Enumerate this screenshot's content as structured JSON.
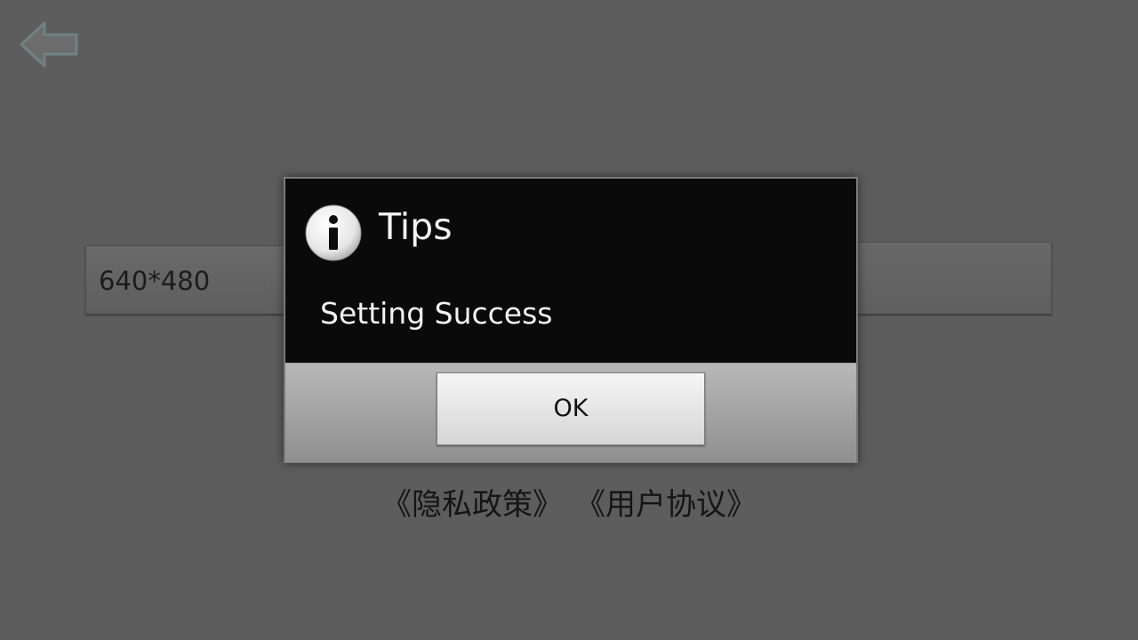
{
  "background": {
    "resolution_select": {
      "value": "640*480"
    },
    "ok_button": {
      "label": "OK"
    },
    "links": {
      "privacy_policy": "《隐私政策》",
      "user_agreement": "《用户协议》"
    }
  },
  "dialog": {
    "icon": "info-icon",
    "title": "Tips",
    "message": "Setting Success",
    "ok_label": "OK"
  },
  "colors": {
    "overlay_background": "#5d5d5d",
    "dialog_background": "#0a0a0a",
    "dialog_footer": "#a6a6a6",
    "back_arrow": "#6e7e80"
  }
}
